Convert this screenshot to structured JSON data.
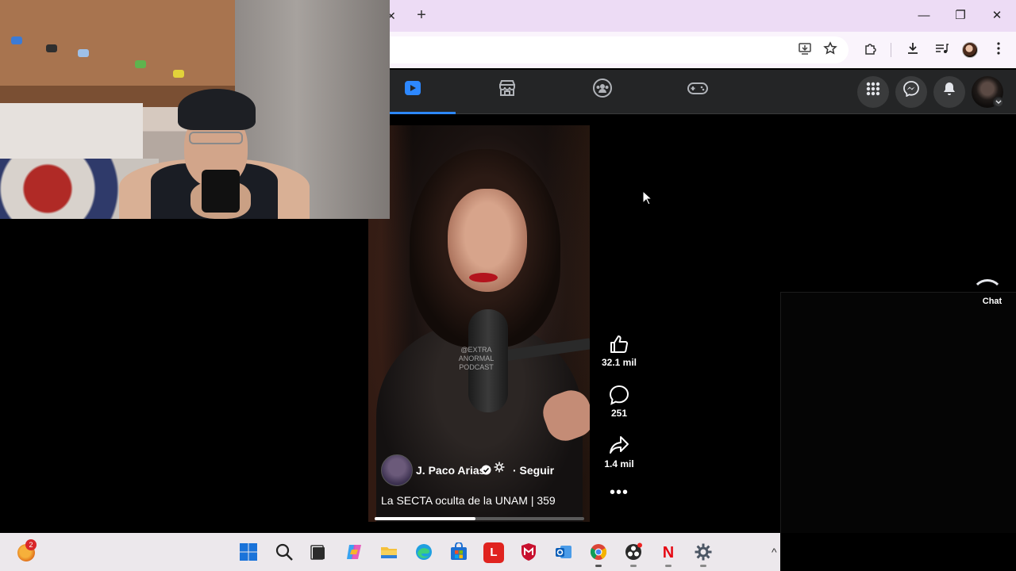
{
  "browser": {
    "tab_close": "✕",
    "new_tab": "+",
    "window_controls": [
      "—",
      "❐",
      "✕"
    ]
  },
  "facebook": {
    "nav_icons": [
      "video-icon",
      "marketplace-icon",
      "groups-icon",
      "gaming-icon"
    ],
    "accent": "#2d88ff"
  },
  "reel": {
    "author": "J. Paco Arias",
    "follow_label": "· Seguir",
    "caption": "La SECTA oculta de la UNAM | 359",
    "watermark": "@EXTRA ANORMAL PODCAST",
    "progress": 0.48,
    "likes": "32.1 mil",
    "comments": "251",
    "shares": "1.4 mil",
    "more": "•••"
  },
  "chat": {
    "label": "Chat"
  },
  "taskbar": {
    "notification_count": "2",
    "apps": [
      "start",
      "search",
      "file",
      "copilot",
      "folder",
      "edge",
      "store",
      "lumion",
      "mcafee",
      "outlook",
      "chrome",
      "obs",
      "netflix",
      "settings"
    ],
    "overflow": "^"
  }
}
